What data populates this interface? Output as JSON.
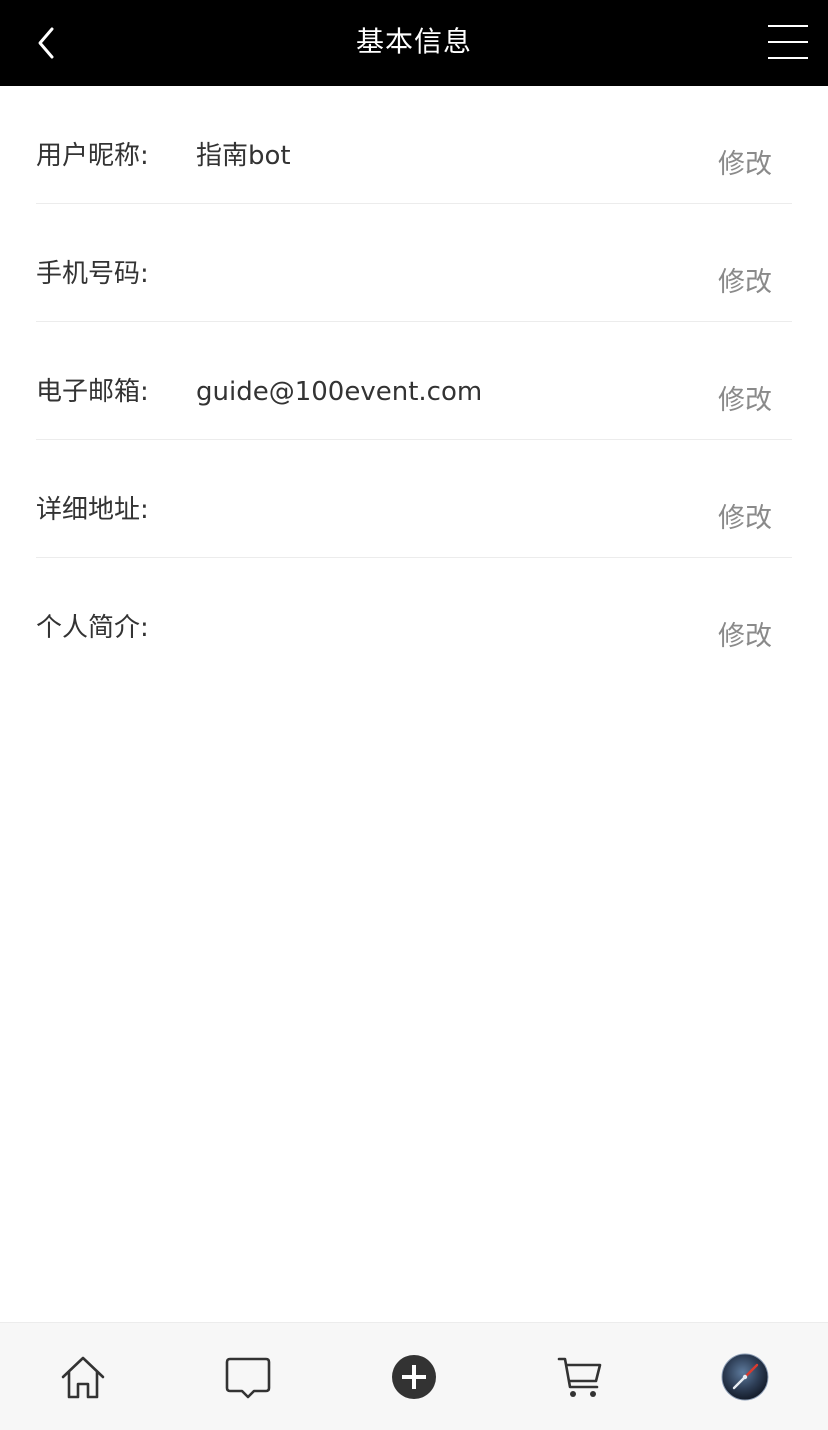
{
  "header": {
    "title": "基本信息",
    "back_icon": "chevron-left-icon",
    "menu_icon": "hamburger-menu-icon"
  },
  "fields": [
    {
      "label": "用户昵称:",
      "value": "指南bot",
      "action": "修改"
    },
    {
      "label": "手机号码:",
      "value": "",
      "action": "修改"
    },
    {
      "label": "电子邮箱:",
      "value": "guide@100event.com",
      "action": "修改"
    },
    {
      "label": "详细地址:",
      "value": "",
      "action": "修改"
    },
    {
      "label": "个人简介:",
      "value": "",
      "action": "修改"
    }
  ],
  "tabbar": {
    "items": [
      {
        "icon": "home-icon"
      },
      {
        "icon": "message-icon"
      },
      {
        "icon": "add-circle-icon"
      },
      {
        "icon": "cart-icon"
      },
      {
        "icon": "avatar"
      }
    ]
  },
  "colors": {
    "header_bg": "#000000",
    "header_text": "#ffffff",
    "label_text": "#333333",
    "action_text": "#8a8a8a",
    "divider": "#ececec",
    "tabbar_bg": "#f7f7f7"
  }
}
